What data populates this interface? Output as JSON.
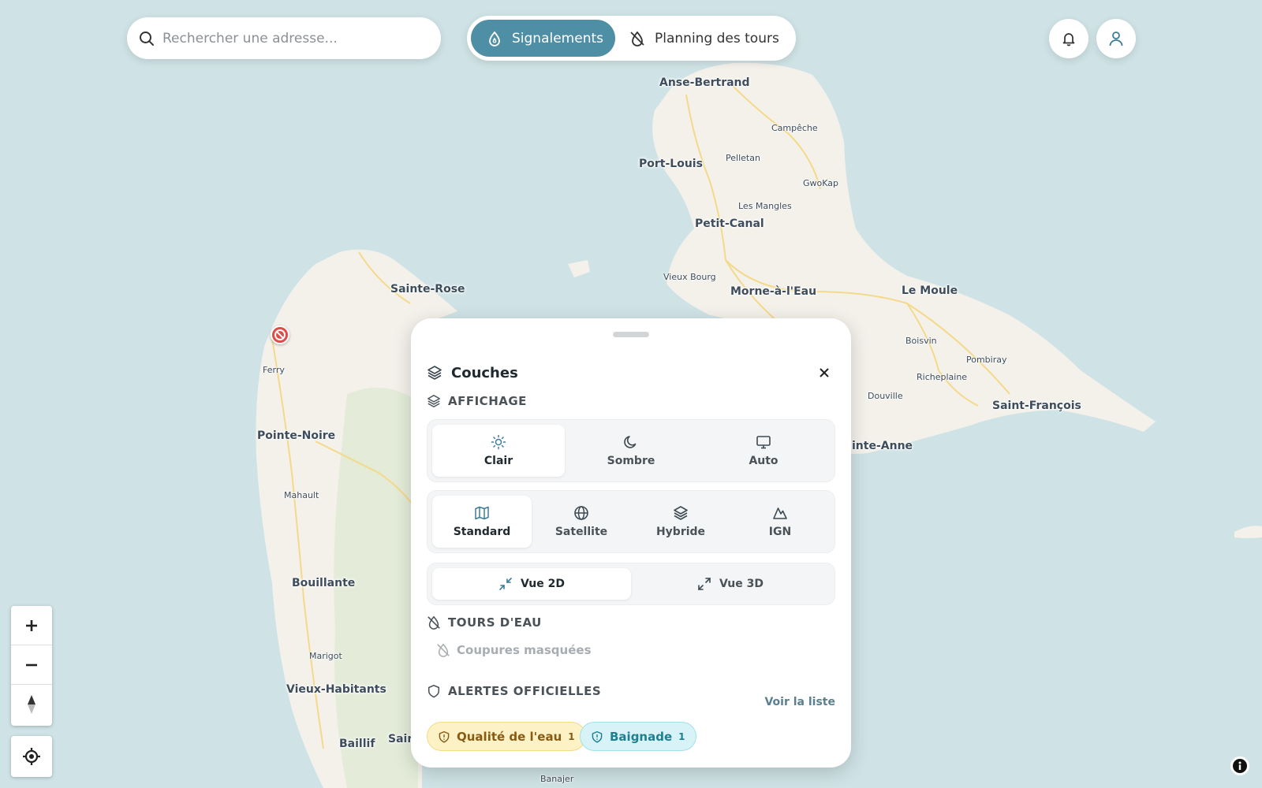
{
  "search": {
    "placeholder": "Rechercher une adresse..."
  },
  "mode_toggle": {
    "options": [
      {
        "label": "Signalements",
        "icon": "droplet-flame-icon",
        "active": true
      },
      {
        "label": "Planning des tours",
        "icon": "droplet-off-icon",
        "active": false
      }
    ]
  },
  "header_actions": {
    "notifications_icon": "bell-icon",
    "profile_icon": "user-icon"
  },
  "map": {
    "places": {
      "anse_bertrand": "Anse-Bertrand",
      "campeche": "Campêche",
      "port_louis": "Port-Louis",
      "pelletan": "Pelletan",
      "gwokap": "GwoKap",
      "les_mangles": "Les Mangles",
      "petit_canal": "Petit-Canal",
      "sainte_rose": "Sainte-Rose",
      "vieux_bourg": "Vieux Bourg",
      "morne_a_leau": "Morne-à-l'Eau",
      "le_moule": "Le Moule",
      "boisvin": "Boisvin",
      "pombiray": "Pombiray",
      "richeplaine": "Richeplaine",
      "douville": "Douville",
      "saint_francois": "Saint-François",
      "sainte_anne": "inte-Anne",
      "ferry": "Ferry",
      "pointe_noire": "Pointe-Noire",
      "mahault": "Mahault",
      "bouillante": "Bouillante",
      "marigot": "Marigot",
      "vieux_habitants": "Vieux-Habitants",
      "baillif": "Baillif",
      "saint_claude": "Sain",
      "banajer": "Banajer"
    },
    "colors": {
      "sea": "#cfe3e6",
      "land": "#f3f1ea",
      "forest": "#e4ecd9",
      "road": "#f5d98a",
      "marker": "#e04a4a"
    }
  },
  "panel": {
    "title": "Couches",
    "affichage": {
      "heading": "AFFICHAGE",
      "themes": [
        {
          "label": "Clair",
          "icon": "sun-icon",
          "selected": true
        },
        {
          "label": "Sombre",
          "icon": "moon-icon",
          "selected": false
        },
        {
          "label": "Auto",
          "icon": "monitor-icon",
          "selected": false
        }
      ],
      "styles": [
        {
          "label": "Standard",
          "icon": "map-icon",
          "selected": true
        },
        {
          "label": "Satellite",
          "icon": "globe-icon",
          "selected": false
        },
        {
          "label": "Hybride",
          "icon": "layers-icon",
          "selected": false
        },
        {
          "label": "IGN",
          "icon": "mountain-icon",
          "selected": false
        }
      ],
      "views": [
        {
          "label": "Vue 2D",
          "icon": "minimize-icon",
          "selected": true
        },
        {
          "label": "Vue 3D",
          "icon": "maximize-icon",
          "selected": false
        }
      ]
    },
    "tours": {
      "heading": "TOURS D'EAU",
      "toggle_label": "Coupures masquées"
    },
    "alertes": {
      "heading": "ALERTES OFFICIELLES",
      "link": "Voir la liste",
      "chips": [
        {
          "label": "Qualité de l'eau",
          "count": "1",
          "color": "#8a5a10"
        },
        {
          "label": "Baignade",
          "count": "1",
          "color": "#1d7f92"
        }
      ]
    }
  }
}
